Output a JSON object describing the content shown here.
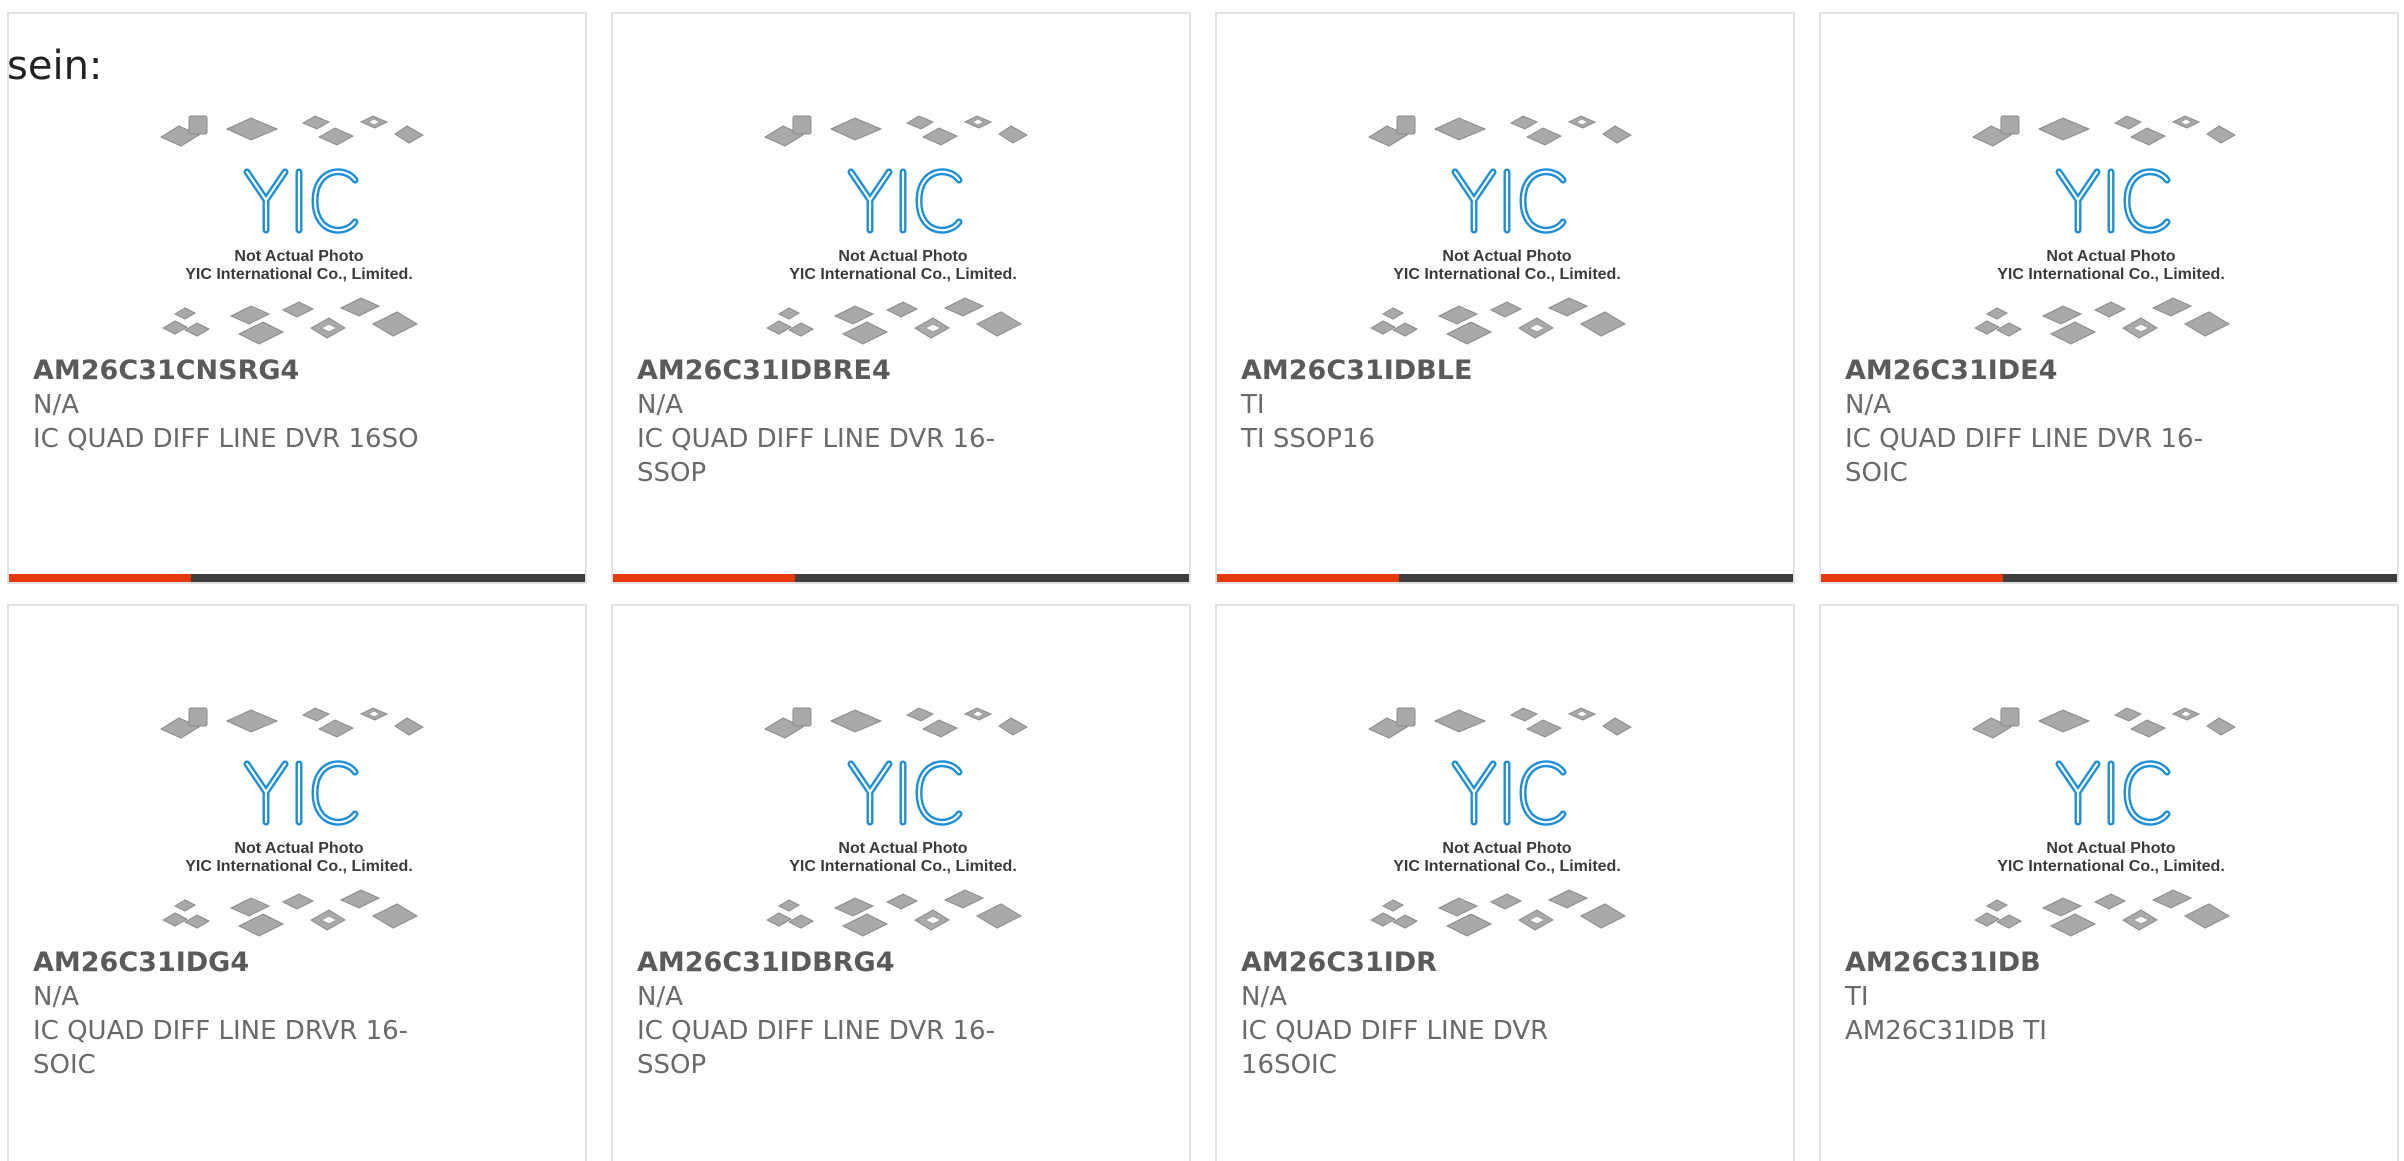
{
  "lead_text": "sein:",
  "photo": {
    "logo_text": "YIC",
    "caption_line1": "Not Actual Photo",
    "caption_line2": "YIC International Co., Limited."
  },
  "colors": {
    "accent": "#e5390f",
    "bar": "#3e3e3e",
    "logo": "#1c8fd6"
  },
  "products": [
    {
      "part": "AM26C31CNSRG4",
      "manufacturer": "N/A",
      "description": "IC QUAD DIFF LINE DVR 16SO"
    },
    {
      "part": "AM26C31IDBRE4",
      "manufacturer": "N/A",
      "description": "IC QUAD DIFF LINE DVR 16-SSOP"
    },
    {
      "part": "AM26C31IDBLE",
      "manufacturer": "TI",
      "description": "TI SSOP16"
    },
    {
      "part": "AM26C31IDE4",
      "manufacturer": "N/A",
      "description": "IC QUAD DIFF LINE DVR 16-SOIC"
    },
    {
      "part": "AM26C31IDG4",
      "manufacturer": "N/A",
      "description": "IC QUAD DIFF LINE DRVR 16-SOIC"
    },
    {
      "part": "AM26C31IDBRG4",
      "manufacturer": "N/A",
      "description": "IC QUAD DIFF LINE DVR 16-SSOP"
    },
    {
      "part": "AM26C31IDR",
      "manufacturer": "N/A",
      "description": "IC QUAD DIFF LINE DVR 16SOIC"
    },
    {
      "part": "AM26C31IDB",
      "manufacturer": "TI",
      "description": "AM26C31IDB TI"
    }
  ]
}
